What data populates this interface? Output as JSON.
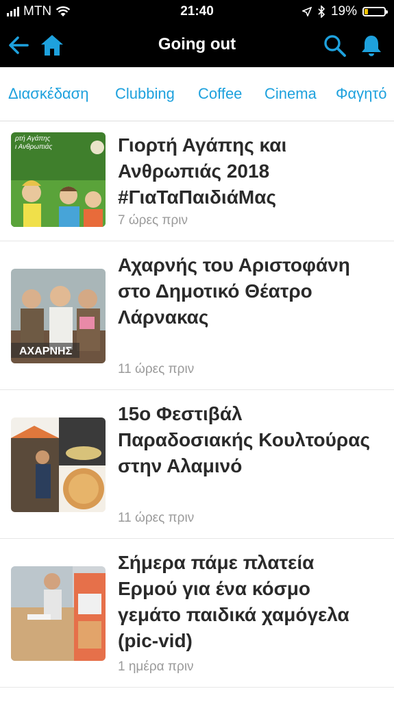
{
  "status_bar": {
    "carrier": "MTN",
    "time": "21:40",
    "battery_percent": "19%",
    "battery_level": 0.19,
    "battery_color": "#f5c400",
    "icons": [
      "signal-icon",
      "wifi-icon",
      "location-icon",
      "bluetooth-icon",
      "battery-icon"
    ]
  },
  "navbar": {
    "title": "Going out",
    "accent_color": "#1ea1dd",
    "icons": [
      "back-arrow-icon",
      "home-icon",
      "search-icon",
      "bell-icon"
    ]
  },
  "tabs": [
    {
      "label": "Διασκέδαση"
    },
    {
      "label": "Clubbing"
    },
    {
      "label": "Coffee"
    },
    {
      "label": "Cinema"
    },
    {
      "label": "Φαγητό"
    }
  ],
  "articles": [
    {
      "title": "Γιορτή Αγάπης και Ανθρωπιάς 2018 #ΓιαΤαΠαιδιάΜας",
      "time": "7 ώρες πριν",
      "thumb_text": "ρτή Αγάπης\nι Ανθρωπιάς"
    },
    {
      "title": "Αχαρνής του Αριστοφάνη στο Δημοτικό Θέατρο Λάρνακας",
      "time": "11 ώρες πριν",
      "thumb_text": "ΑΧΑΡΝΗΣ"
    },
    {
      "title": "15ο Φεστιβάλ Παραδοσιακής Κουλτούρας στην Αλαμινό",
      "time": "11 ώρες πριν",
      "thumb_text": ""
    },
    {
      "title": "Σήμερα πάμε πλατεία Ερμού για ένα κόσμο γεμάτο παιδικά χαμόγελα (pic-vid)",
      "time": "1 ημέρα πριν",
      "thumb_text": ""
    }
  ]
}
